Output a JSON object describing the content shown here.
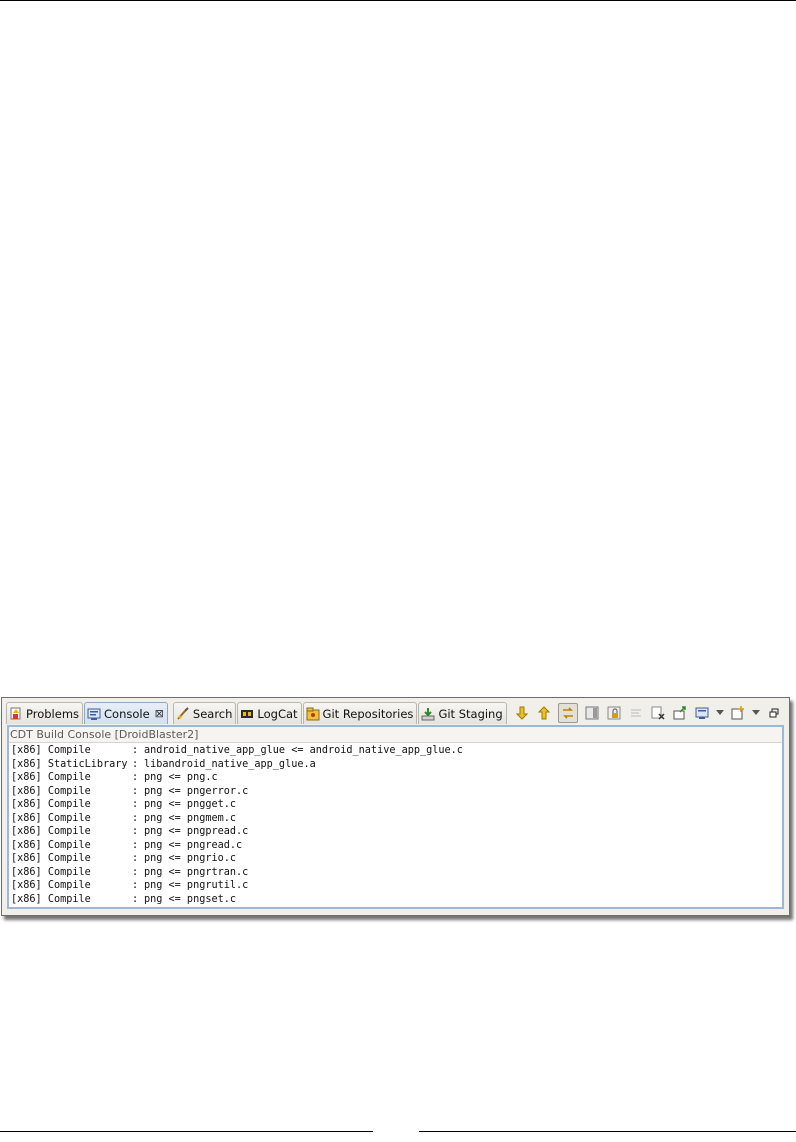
{
  "tabs": [
    {
      "label": "Problems",
      "icon": "problems-icon",
      "active": false
    },
    {
      "label": "Console",
      "icon": "console-icon",
      "active": true
    },
    {
      "label": "Search",
      "icon": "search-icon",
      "active": false
    },
    {
      "label": "LogCat",
      "icon": "logcat-icon",
      "active": false
    },
    {
      "label": "Git Repositories",
      "icon": "git-repositories-icon",
      "active": false
    },
    {
      "label": "Git Staging",
      "icon": "git-staging-icon",
      "active": false
    }
  ],
  "console_close_glyph": "⊠",
  "toolbar": [
    "scroll-down-icon",
    "scroll-up-icon",
    "link-with-editor-icon",
    "pin-console-icon",
    "lock-icon",
    "clear-icon",
    "remove-icon",
    "open-console-icon",
    "display-selected-console-icon",
    "new-console-icon",
    "minimize-icon"
  ],
  "console": {
    "title": "CDT Build Console [DroidBlaster2]",
    "lines": [
      {
        "arch": "[x86]",
        "action": "Compile",
        "sep": ":",
        "detail": "android_native_app_glue <= android_native_app_glue.c"
      },
      {
        "arch": "[x86]",
        "action": "StaticLibrary",
        "sep": ":",
        "detail": "libandroid_native_app_glue.a"
      },
      {
        "arch": "[x86]",
        "action": "Compile",
        "sep": ":",
        "detail": "png <= png.c"
      },
      {
        "arch": "[x86]",
        "action": "Compile",
        "sep": ":",
        "detail": "png <= pngerror.c"
      },
      {
        "arch": "[x86]",
        "action": "Compile",
        "sep": ":",
        "detail": "png <= pngget.c"
      },
      {
        "arch": "[x86]",
        "action": "Compile",
        "sep": ":",
        "detail": "png <= pngmem.c"
      },
      {
        "arch": "[x86]",
        "action": "Compile",
        "sep": ":",
        "detail": "png <= pngpread.c"
      },
      {
        "arch": "[x86]",
        "action": "Compile",
        "sep": ":",
        "detail": "png <= pngread.c"
      },
      {
        "arch": "[x86]",
        "action": "Compile",
        "sep": ":",
        "detail": "png <= pngrio.c"
      },
      {
        "arch": "[x86]",
        "action": "Compile",
        "sep": ":",
        "detail": "png <= pngrtran.c"
      },
      {
        "arch": "[x86]",
        "action": "Compile",
        "sep": ":",
        "detail": "png <= pngrutil.c"
      },
      {
        "arch": "[x86]",
        "action": "Compile",
        "sep": ":",
        "detail": "png <= pngset.c"
      }
    ]
  }
}
